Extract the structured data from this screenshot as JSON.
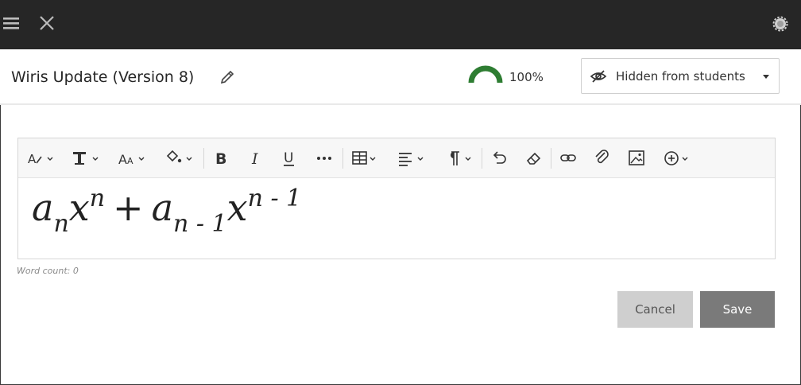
{
  "topbar": {
    "menu_icon": "hamburger-icon",
    "close_icon": "close-icon",
    "settings_icon": "gear-icon"
  },
  "header": {
    "title": "Wiris Update (Version 8)",
    "edit_icon": "pencil-icon",
    "progress_percent_text": "100%",
    "progress_value": 1.0,
    "progress_color": "#2e7d32",
    "visibility_label": "Hidden from students",
    "visibility_icon": "eye-slash-icon"
  },
  "toolbar": {
    "buttons": [
      "paragraph-style-icon",
      "formatting-icon",
      "font-size-icon",
      "text-color-icon",
      "bold-icon",
      "italic-icon",
      "underline-icon",
      "more-icon",
      "table-icon",
      "align-icon",
      "paragraph-icon",
      "undo-icon",
      "eraser-icon",
      "link-icon",
      "attachment-icon",
      "image-icon",
      "insert-icon"
    ],
    "bold_label": "B",
    "italic_label": "I",
    "underline_label": "U"
  },
  "editor": {
    "formula": {
      "t1_base": "a",
      "t1_sub": "n",
      "t1_var": "x",
      "t1_sup": "n",
      "op": "+",
      "t2_base": "a",
      "t2_sub": "n - 1",
      "t2_var": "x",
      "t2_sup": "n - 1"
    }
  },
  "word_count": "Word count: 0",
  "actions": {
    "cancel_label": "Cancel",
    "save_label": "Save"
  },
  "colors": {
    "topbar_bg": "#262626",
    "cancel_bg": "#cfcfcf",
    "save_bg": "#7a7a7a",
    "accent_green": "#2e7d32"
  }
}
